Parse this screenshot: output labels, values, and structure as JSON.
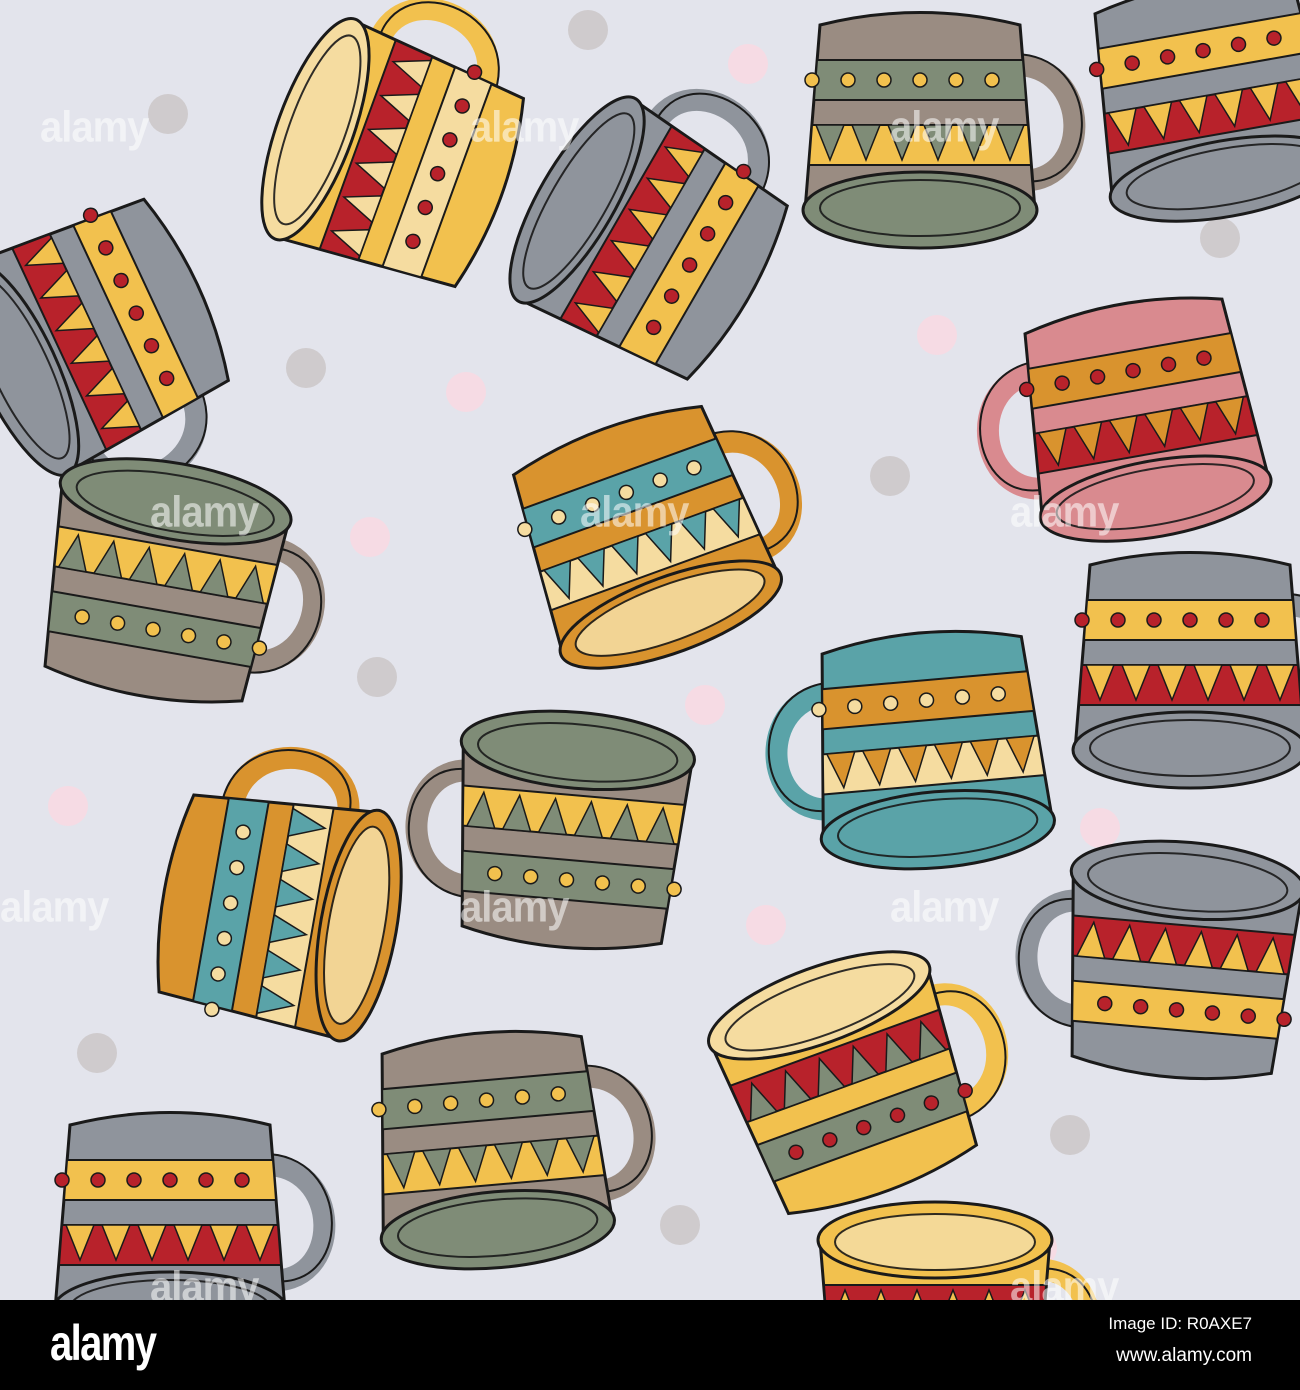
{
  "watermark": "alamy",
  "footer": {
    "logo": "alamy",
    "image_id": "Image ID: R0AXE7",
    "website": "www.alamy.com"
  },
  "colors": {
    "background": "#e3e4ec",
    "outline": "#1a1a1a",
    "gray": "#8f949c",
    "red": "#b8222b",
    "yellow": "#f2c14e",
    "cream": "#f5dca0",
    "taupe": "#9a8c82",
    "green": "#7f8c77",
    "orange": "#d9932e",
    "teal": "#5aa3a8",
    "pink": "#d98a8f",
    "dot_gray": "#cfcbcd",
    "dot_pink": "#f6dbe4"
  }
}
